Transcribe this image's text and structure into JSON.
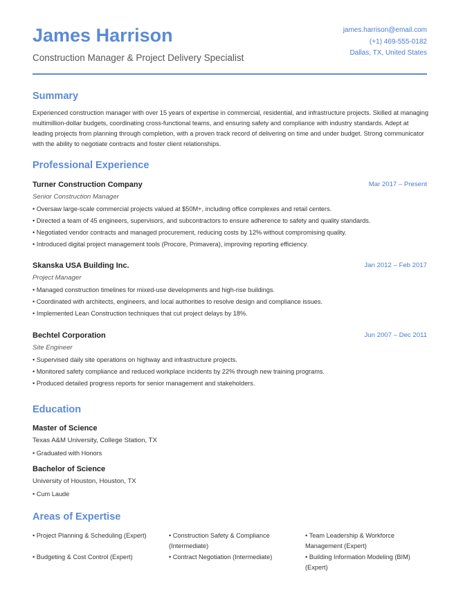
{
  "header": {
    "name": "James Harrison",
    "title": "Construction Manager & Project Delivery Specialist",
    "email": "james.harrison@email.com",
    "phone": "(+1) 469-555-0182",
    "location": "Dallas, TX, United States"
  },
  "summary": {
    "heading": "Summary",
    "text": "Experienced construction manager with over 15 years of expertise in commercial, residential, and infrastructure projects. Skilled at managing multimillion-dollar budgets, coordinating cross-functional teams, and ensuring safety and compliance with industry standards. Adept at leading projects from planning through completion, with a proven track record of delivering on time and under budget. Strong communicator with the ability to negotiate contracts and foster client relationships."
  },
  "experience": {
    "heading": "Professional Experience",
    "jobs": [
      {
        "company": "Turner Construction Company",
        "dates": "Mar 2017 – Present",
        "role": "Senior Construction Manager",
        "bullets": [
          "• Oversaw large-scale commercial projects valued at $50M+, including office complexes and retail centers.",
          "• Directed a team of 45 engineers, supervisors, and subcontractors to ensure adherence to safety and quality standards.",
          "• Negotiated vendor contracts and managed procurement, reducing costs by 12% without compromising quality.",
          "• Introduced digital project management tools (Procore, Primavera), improving reporting efficiency."
        ]
      },
      {
        "company": "Skanska USA Building Inc.",
        "dates": "Jan 2012 – Feb 2017",
        "role": "Project Manager",
        "bullets": [
          "• Managed construction timelines for mixed-use developments and high-rise buildings.",
          "• Coordinated with architects, engineers, and local authorities to resolve design and compliance issues.",
          "• Implemented Lean Construction techniques that cut project delays by 18%."
        ]
      },
      {
        "company": "Bechtel Corporation",
        "dates": "Jun 2007 – Dec 2011",
        "role": "Site Engineer",
        "bullets": [
          "• Supervised daily site operations on highway and infrastructure projects.",
          "• Monitored safety compliance and reduced workplace incidents by 22% through new training programs.",
          "• Produced detailed progress reports for senior management and stakeholders."
        ]
      }
    ]
  },
  "education": {
    "heading": "Education",
    "items": [
      {
        "degree": "Master of Science",
        "school": "Texas A&M University, College Station, TX",
        "note": "• Graduated with Honors"
      },
      {
        "degree": "Bachelor of Science",
        "school": "University of Houston, Houston, TX",
        "note": "• Cum Laude"
      }
    ]
  },
  "expertise": {
    "heading": "Areas of Expertise",
    "items": [
      "• Project Planning & Scheduling (Expert)",
      "• Construction Safety & Compliance (Intermediate)",
      "• Team Leadership & Workforce Management (Expert)",
      "• Budgeting & Cost Control (Expert)",
      "• Contract Negotiation (Intermediate)",
      "• Building Information Modeling (BIM) (Expert)"
    ]
  },
  "colors": {
    "accent": "#5b8ad6",
    "link": "#4a7bd0"
  }
}
